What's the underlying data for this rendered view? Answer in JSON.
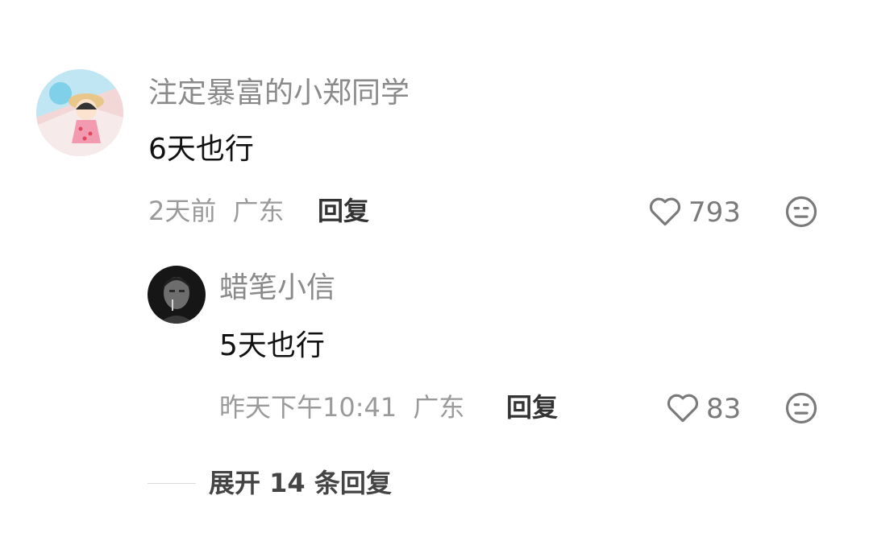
{
  "comment": {
    "username": "注定暴富的小郑同学",
    "text": "6天也行",
    "time": "2天前",
    "location": "广东",
    "reply_label": "回复",
    "like_count": "793",
    "icons": {
      "like": "heart-outline-icon",
      "dislike": "unhappy-face-icon"
    }
  },
  "reply": {
    "username": "蜡笔小信",
    "text": "5天也行",
    "time": "昨天下午10:41",
    "location": "广东",
    "reply_label": "回复",
    "like_count": "83",
    "icons": {
      "like": "heart-outline-icon",
      "dislike": "unhappy-face-icon"
    }
  },
  "expand": {
    "label": "展开 14 条回复"
  }
}
